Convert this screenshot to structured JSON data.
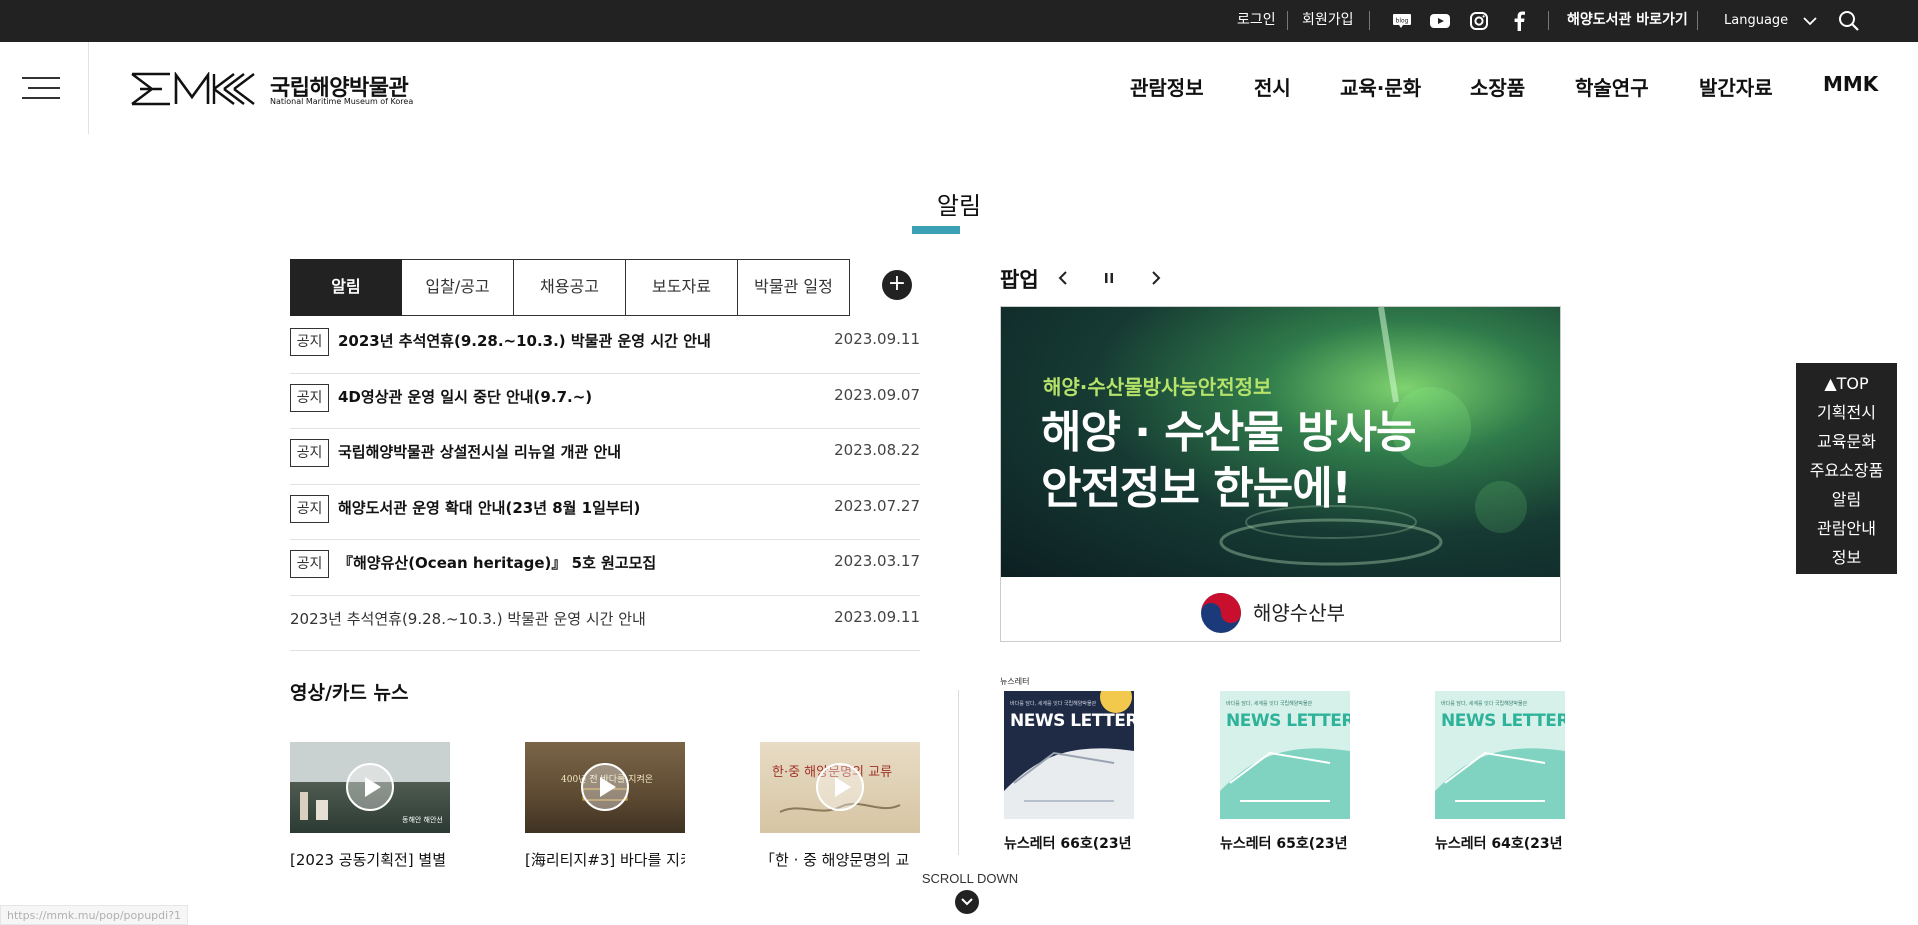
{
  "utility_bar": {
    "login": "로그인",
    "signup": "회원가입",
    "library_link": "해양도서관 바로가기",
    "language": "Language",
    "blog_label": "blog",
    "icons": [
      "blog-icon",
      "youtube-icon",
      "instagram-icon",
      "facebook-icon",
      "chevron-down-icon",
      "search-icon"
    ]
  },
  "header": {
    "logo_ko": "국립해양박물관",
    "logo_en": "National Maritime Museum of Korea",
    "nav": [
      "관람정보",
      "전시",
      "교육·문화",
      "소장품",
      "학술연구",
      "발간자료",
      "MMK"
    ]
  },
  "section": {
    "title": "알림"
  },
  "notice": {
    "tabs": [
      "알림",
      "입찰/공고",
      "채용공고",
      "보도자료",
      "박물관 일정"
    ],
    "active_tab": "알림",
    "more": "+",
    "items": [
      {
        "badge": "공지",
        "title": "2023년 추석연휴(9.28.~10.3.) 박물관 운영 시간 안내",
        "date": "2023.09.11"
      },
      {
        "badge": "공지",
        "title": "4D영상관 운영 일시 중단 안내(9.7.~)",
        "date": "2023.09.07"
      },
      {
        "badge": "공지",
        "title": "국립해양박물관 상설전시실 리뉴얼 개관 안내",
        "date": "2023.08.22"
      },
      {
        "badge": "공지",
        "title": "해양도서관 운영 확대 안내(23년 8월 1일부터)",
        "date": "2023.07.27"
      },
      {
        "badge": "공지",
        "title": "『해양유산(Ocean heritage)』 5호 원고모집",
        "date": "2023.03.17"
      },
      {
        "badge": "",
        "title": "2023년 추석연휴(9.28.~10.3.) 박물관 운영 시간 안내",
        "date": "2023.09.11"
      }
    ]
  },
  "popup": {
    "label": "팝업",
    "banner_sub": "해양·수산물방사능안전정보",
    "banner_line1": "해양 · 수산물 방사능",
    "banner_line2": "안전정보 한눈에!",
    "ministry": "해양수산부"
  },
  "video_news": {
    "title": "영상/카드 뉴스",
    "items": [
      {
        "caption": "[2023 공동기획전] 별별",
        "thumb_text": "동해안 해안선"
      },
      {
        "caption": "[海리티지#3] 바다를 지키",
        "thumb_text": "400년 전 바다를 지켜온"
      },
      {
        "caption": "「한 · 중 해양문명의 교",
        "thumb_text": "한·중 해양문명의 교류"
      }
    ]
  },
  "newsletter": {
    "label": "뉴스레터",
    "items": [
      {
        "caption": "뉴스레터 66호(23년",
        "head": "NEWS LETTER",
        "theme": "navy"
      },
      {
        "caption": "뉴스레터 65호(23년",
        "head": "NEWS LETTER",
        "theme": "mint"
      },
      {
        "caption": "뉴스레터 64호(23년",
        "head": "NEWS LETTER",
        "theme": "mint"
      }
    ],
    "cover_top": "바다를 담다, 세계를 잇다 국립해양박물관"
  },
  "quick_menu": [
    "▲TOP",
    "기획전시",
    "교육문화",
    "주요소장품",
    "알림",
    "관람안내",
    "정보"
  ],
  "scroll": {
    "label": "SCROLL DOWN"
  },
  "status_bar": {
    "url": "https://mmk.mu/pop/popupdi?1"
  },
  "colors": {
    "utility_bg": "#222222",
    "accent": "#3aa0b3",
    "dark": "#222222"
  }
}
